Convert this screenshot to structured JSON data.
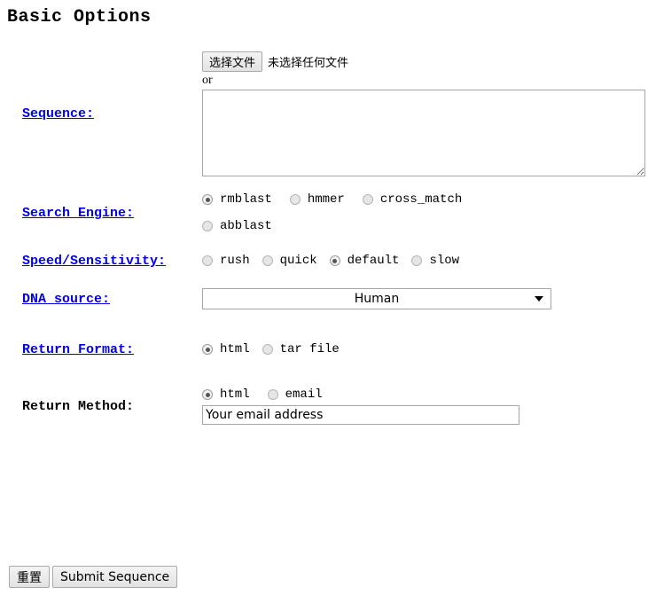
{
  "page": {
    "title": "Basic Options"
  },
  "sequence": {
    "label": "Sequence:",
    "file_button_label": "选择文件",
    "file_status_text": "未选择任何文件",
    "or_text": "or",
    "textarea_value": "",
    "textarea_placeholder": ""
  },
  "search_engine": {
    "label": "Search Engine:",
    "options": [
      {
        "value": "rmblast",
        "label": "rmblast",
        "selected": true
      },
      {
        "value": "hmmer",
        "label": "hmmer",
        "selected": false
      },
      {
        "value": "cross_match",
        "label": "cross_match",
        "selected": false
      },
      {
        "value": "abblast",
        "label": "abblast",
        "selected": false
      }
    ]
  },
  "speed_sensitivity": {
    "label": "Speed/Sensitivity:",
    "options": [
      {
        "value": "rush",
        "label": "rush",
        "selected": false
      },
      {
        "value": "quick",
        "label": "quick",
        "selected": false
      },
      {
        "value": "default",
        "label": "default",
        "selected": true
      },
      {
        "value": "slow",
        "label": "slow",
        "selected": false
      }
    ]
  },
  "dna_source": {
    "label": "DNA source:",
    "selected": "Human"
  },
  "return_format": {
    "label": "Return Format:",
    "options": [
      {
        "value": "html",
        "label": "html",
        "selected": true
      },
      {
        "value": "tar",
        "label": "tar file",
        "selected": false
      }
    ]
  },
  "return_method": {
    "label": "Return Method:",
    "options": [
      {
        "value": "html",
        "label": "html",
        "selected": true
      },
      {
        "value": "email",
        "label": "email",
        "selected": false
      }
    ],
    "email_value": "Your email address"
  },
  "buttons": {
    "reset_label": "重置",
    "submit_label": "Submit Sequence"
  }
}
